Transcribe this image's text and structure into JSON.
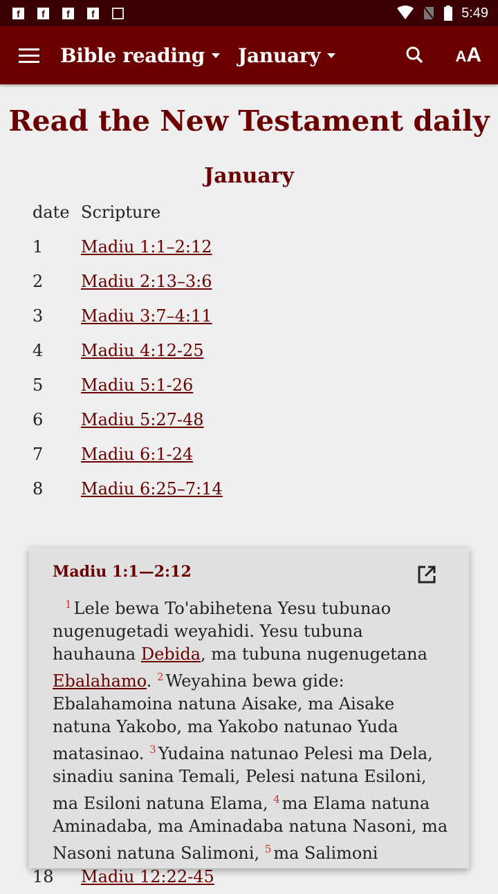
{
  "status_bar": {
    "time": "5:49",
    "notifications": [
      "facebook-icon",
      "facebook-icon",
      "facebook-icon",
      "facebook-icon",
      "image-icon"
    ]
  },
  "app_bar": {
    "book_selector": "Bible reading",
    "month_selector": "January"
  },
  "page": {
    "title": "Read the New Testament daily",
    "month_heading": "January",
    "columns": {
      "date": "date",
      "scripture": "Scripture"
    },
    "rows": [
      {
        "date": "1",
        "ref": "Madiu 1:1–2:12"
      },
      {
        "date": "2",
        "ref": "Madiu 2:13–3:6"
      },
      {
        "date": "3",
        "ref": "Madiu 3:7–4:11"
      },
      {
        "date": "4",
        "ref": "Madiu 4:12-25"
      },
      {
        "date": "5",
        "ref": "Madiu 5:1-26"
      },
      {
        "date": "6",
        "ref": "Madiu 5:27-48"
      },
      {
        "date": "7",
        "ref": "Madiu 6:1-24"
      },
      {
        "date": "8",
        "ref": "Madiu 6:25–7:14"
      }
    ],
    "last_visible_row": {
      "date": "18",
      "ref": "Madiu 12:22-45"
    }
  },
  "popup": {
    "title": "Madiu 1:1—2:12",
    "segments": [
      {
        "v": "1"
      },
      {
        "t": "Lele bewa To'abihetena Yesu tubunao nugenugetadi weyahidi. Yesu tubuna hauhauna "
      },
      {
        "l": "Debida"
      },
      {
        "t": ", ma tubuna nugenugetana "
      },
      {
        "l": "Ebalahamo"
      },
      {
        "t": ". "
      },
      {
        "v": "2"
      },
      {
        "t": "Weyahina bewa gide: Ebalahamoina natuna Aisake, ma Aisake natuna Yakobo, ma Yakobo natunao Yuda matasinao. "
      },
      {
        "v": "3"
      },
      {
        "t": "Yudaina natunao Pelesi ma Dela, sinadiu sanina Temali, Pelesi natuna Esiloni, ma Esiloni natuna Elama, "
      },
      {
        "v": "4"
      },
      {
        "t": "ma Elama natuna Aminadaba, ma Aminadaba natuna Nasoni, ma Nasoni natuna Salimoni, "
      },
      {
        "v": "5"
      },
      {
        "t": "ma Salimoni mwanena Levabi ma natudiu Bwasa, ma Bwasa"
      }
    ]
  },
  "colors": {
    "primary": "#6b0000",
    "status_bar": "#3a0004",
    "verse_number": "#d03030"
  }
}
